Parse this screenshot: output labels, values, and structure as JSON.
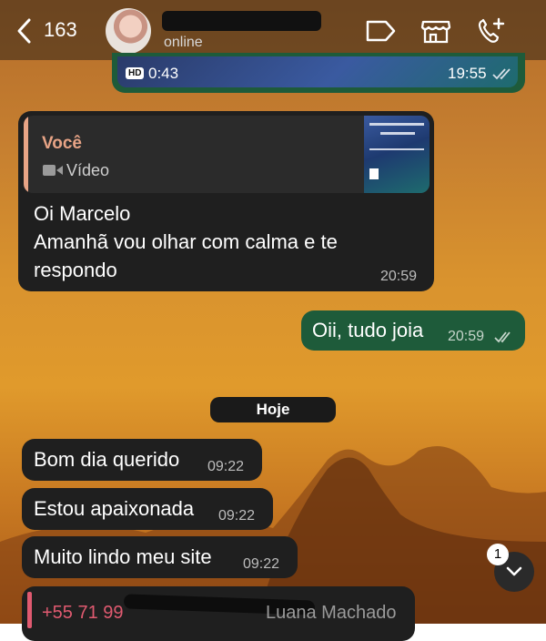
{
  "header": {
    "back_count": "163",
    "status": "online"
  },
  "video_bubble": {
    "hd_label": "HD",
    "duration": "0:43",
    "time": "19:55"
  },
  "reply_bubble": {
    "quote_author": "Você",
    "quote_type": "Vídeo",
    "lines": [
      "Oi Marcelo",
      "Amanhã vou olhar com calma e te",
      "respondo"
    ],
    "time": "20:59"
  },
  "out_bubble": {
    "text": "Oii, tudo joia",
    "time": "20:59"
  },
  "date_separator": "Hoje",
  "incoming": [
    {
      "text": "Bom dia querido",
      "time": "09:22"
    },
    {
      "text": "Estou apaixonada",
      "time": "09:22"
    },
    {
      "text": "Muito lindo meu site",
      "time": "09:22"
    }
  ],
  "contact_card": {
    "phone": "+55 71 99",
    "name": "Luana Machado"
  },
  "unread_badge": "1",
  "colors": {
    "incoming_bubble": "#1f1f1f",
    "outgoing_bubble": "#1e5b3a",
    "quote_author": "#e8a486",
    "contact_phone": "#e05a70"
  }
}
